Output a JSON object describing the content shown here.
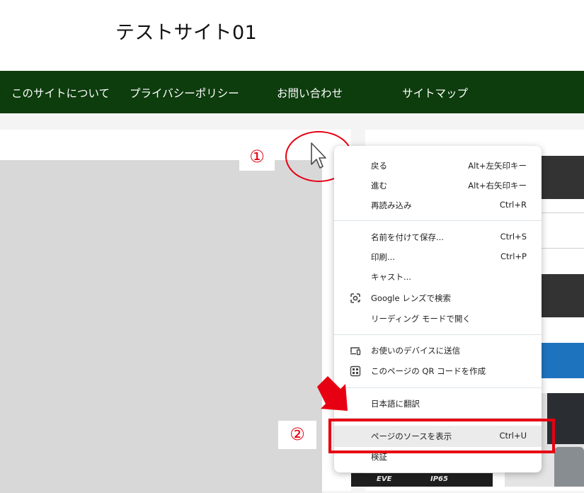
{
  "site": {
    "title": "テストサイト01"
  },
  "nav": {
    "bg_color": "#0d3c0d",
    "items": [
      {
        "label": "このサイトについて"
      },
      {
        "label": "プライバシーポリシー"
      },
      {
        "label": "お問い合わせ"
      },
      {
        "label": "サイトマップ"
      }
    ]
  },
  "annotations": {
    "step1": "①",
    "step2": "②",
    "accent_color": "#e60012"
  },
  "context_menu": {
    "items": [
      {
        "label": "戻る",
        "shortcut": "Alt+左矢印キー"
      },
      {
        "label": "進む",
        "shortcut": "Alt+右矢印キー"
      },
      {
        "label": "再読み込み",
        "shortcut": "Ctrl+R"
      },
      {
        "label": "名前を付けて保存...",
        "shortcut": "Ctrl+S"
      },
      {
        "label": "印刷...",
        "shortcut": "Ctrl+P"
      },
      {
        "label": "キャスト..."
      },
      {
        "label": "Google レンズで検索",
        "icon": "google-lens-icon"
      },
      {
        "label": "リーディング モードで開く"
      },
      {
        "label": "お使いのデバイスに送信",
        "icon": "devices-icon"
      },
      {
        "label": "このページの QR コードを作成",
        "icon": "qr-code-icon"
      },
      {
        "label": "日本語に翻訳"
      },
      {
        "label": "ページのソースを表示",
        "shortcut": "Ctrl+U",
        "highlighted": true
      },
      {
        "label": "検証"
      }
    ]
  },
  "sidebar_product": {
    "brand": "EVE",
    "rating": "IP65"
  }
}
